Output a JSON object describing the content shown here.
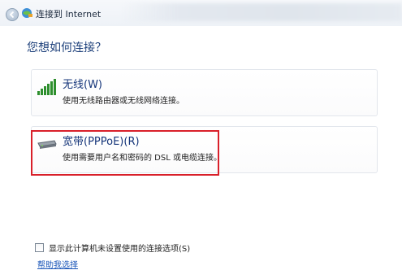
{
  "window": {
    "title": "连接到 Internet"
  },
  "main": {
    "question": "您想如何连接？",
    "options": [
      {
        "title": "无线(W)",
        "description": "使用无线路由器或无线网络连接。",
        "icon": "signal-bars-icon"
      },
      {
        "title": "宽带(PPPoE)(R)",
        "description": "使用需要用户名和密码的 DSL 或电缆连接。",
        "icon": "modem-icon",
        "highlighted": true
      }
    ],
    "highlight_color": "#d9202a"
  },
  "footer": {
    "checkbox_label": "显示此计算机未设置使用的连接选项(S)",
    "checkbox_checked": false,
    "help_link": "帮助我选择"
  }
}
